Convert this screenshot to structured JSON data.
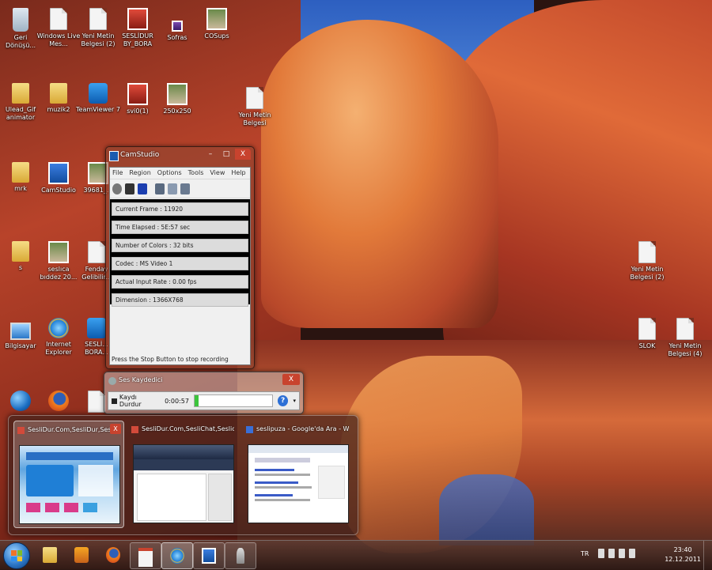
{
  "desktop": {
    "icons": [
      {
        "label": "Geri Dönüşü...",
        "kind": "bin"
      },
      {
        "label": "Windows Live Mes...",
        "kind": "doc"
      },
      {
        "label": "Yeni Metin Belgesi (2)",
        "kind": "doc"
      },
      {
        "label": "SESLİDUR BY_BORA",
        "kind": "red"
      },
      {
        "label": "Sofras",
        "kind": "music"
      },
      {
        "label": "COSups",
        "kind": "photo"
      },
      {
        "label": "Ulead_Gif animator",
        "kind": "folder"
      },
      {
        "label": "muzik2",
        "kind": "folder"
      },
      {
        "label": "TeamViewer 7",
        "kind": "teamviewer"
      },
      {
        "label": "svi0(1)",
        "kind": "red"
      },
      {
        "label": "250x250",
        "kind": "photo"
      },
      {
        "label": "Yeni Metin Belgesi",
        "kind": "doc"
      },
      {
        "label": "mrk",
        "kind": "folder"
      },
      {
        "label": "CamStudio",
        "kind": "blue"
      },
      {
        "label": "39681_...",
        "kind": "photo"
      },
      {
        "label": "s",
        "kind": "folder"
      },
      {
        "label": "seslıca bıddez 20...",
        "kind": "photo"
      },
      {
        "label": "Fenday Gelibilir...",
        "kind": "doc"
      },
      {
        "label": "Yeni Metin Belgesi (2)",
        "kind": "doc"
      },
      {
        "label": "Bilgisayar",
        "kind": "pc"
      },
      {
        "label": "Internet Explorer",
        "kind": "ie"
      },
      {
        "label": "SESLİ... BORA...",
        "kind": "teamviewer"
      },
      {
        "label": "SLOK",
        "kind": "doc"
      },
      {
        "label": "Yeni Metin Belgesi (4)",
        "kind": "doc"
      },
      {
        "label": "",
        "kind": "globe"
      },
      {
        "label": "",
        "kind": "firefox"
      },
      {
        "label": "",
        "kind": "doc"
      }
    ]
  },
  "camstudio": {
    "title": "CamStudio",
    "menu": [
      "File",
      "Region",
      "Options",
      "Tools",
      "View",
      "Help"
    ],
    "stats": [
      "Current Frame : 11920",
      "Time Elapsed : 5E:57 sec",
      "Number of Colors : 32 bits",
      "Codec : MS Video 1",
      "Actual Input Rate : 0.00 fps",
      "Dimension : 1366X768"
    ],
    "status": "Press the Stop Button to stop recording",
    "buttons": {
      "minimize": "–",
      "maximize": "□",
      "close": "X"
    }
  },
  "sound_recorder": {
    "title": "Ses Kaydedici",
    "stop_label": "Kaydı Durdur",
    "elapsed": "0:00:57",
    "level": 0.05,
    "help": "?",
    "close": "X"
  },
  "thumbnails": [
    {
      "title": "SesliDur.Com,SesliDur,SesliC...",
      "active": true,
      "close": "X"
    },
    {
      "title": "SesliDur.Com,SesliChat,Seslio...",
      "active": false
    },
    {
      "title": "seslipuza - Google'da Ara - Win...",
      "active": false
    }
  ],
  "taskbar": {
    "buttons": [
      "explorer",
      "media-player",
      "firefox",
      "camstudio-doc",
      "internet-explorer",
      "camstudio",
      "sound-recorder"
    ],
    "tray": {
      "language": "TR",
      "time": "23:40",
      "date": "12.12.2011"
    }
  },
  "colors": {
    "close_red": "#c8432e",
    "accent_blue": "#1c5bb0",
    "win_green": "#7dbb2a",
    "win_orange": "#f0742a",
    "win_yellow": "#f6c428"
  }
}
